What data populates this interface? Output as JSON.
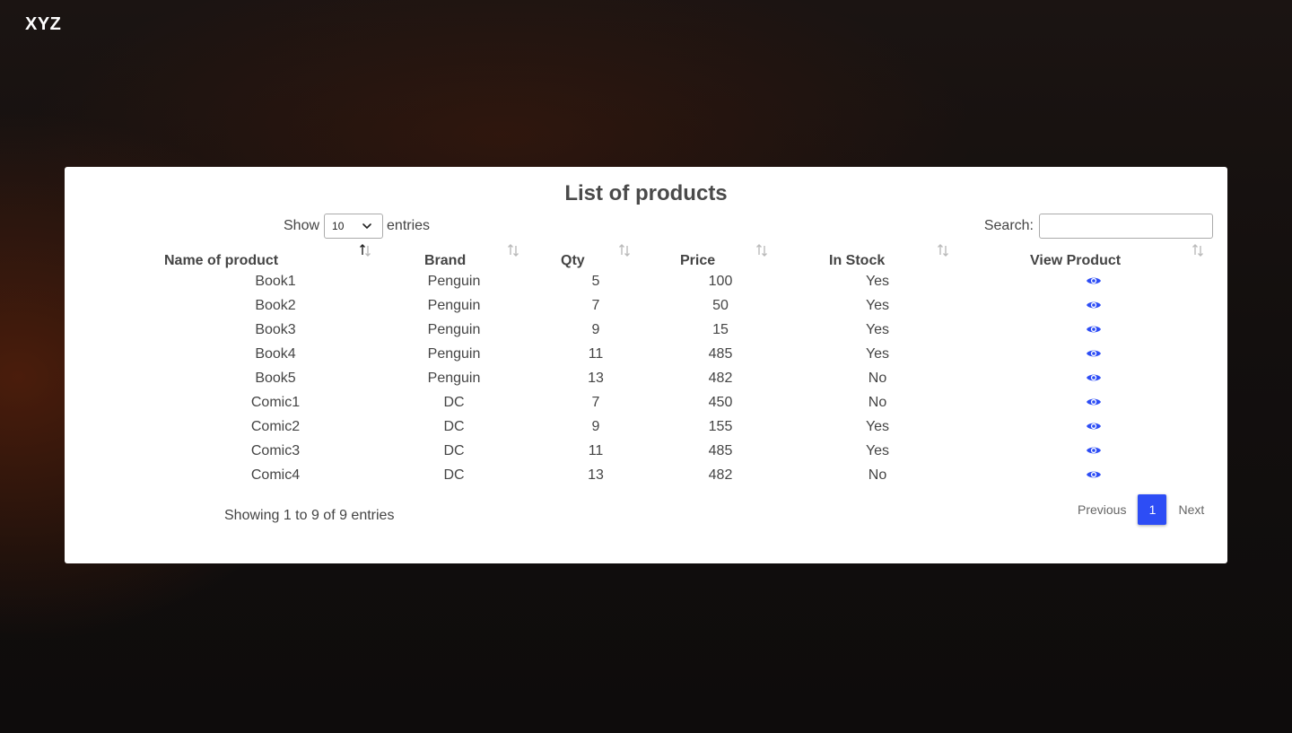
{
  "header": {
    "logo": "XYZ"
  },
  "card": {
    "title": "List of products"
  },
  "controls": {
    "show_label": "Show",
    "page_length": "10",
    "entries_label": "entries",
    "search_label": "Search:",
    "search_value": ""
  },
  "table": {
    "columns": [
      "Name of product",
      "Brand",
      "Qty",
      "Price",
      "In Stock",
      "View Product"
    ],
    "sorted_column": "Name of product",
    "sort_direction": "ascending",
    "rows": [
      [
        "Book1",
        "Penguin",
        "5",
        "100",
        "Yes"
      ],
      [
        "Book2",
        "Penguin",
        "7",
        "50",
        "Yes"
      ],
      [
        "Book3",
        "Penguin",
        "9",
        "15",
        "Yes"
      ],
      [
        "Book4",
        "Penguin",
        "11",
        "485",
        "Yes"
      ],
      [
        "Book5",
        "Penguin",
        "13",
        "482",
        "No"
      ],
      [
        "Comic1",
        "DC",
        "7",
        "450",
        "No"
      ],
      [
        "Comic2",
        "DC",
        "9",
        "155",
        "Yes"
      ],
      [
        "Comic3",
        "DC",
        "11",
        "485",
        "Yes"
      ],
      [
        "Comic4",
        "DC",
        "13",
        "482",
        "No"
      ]
    ],
    "view_icon": "eye-icon"
  },
  "footer": {
    "info": "Showing 1 to 9 of 9 entries",
    "previous": "Previous",
    "current_page": "1",
    "next": "Next"
  },
  "colors": {
    "accent": "#2d4df5",
    "text": "#444444",
    "card_bg": "#ffffff",
    "page_bg": "#130f0e"
  }
}
